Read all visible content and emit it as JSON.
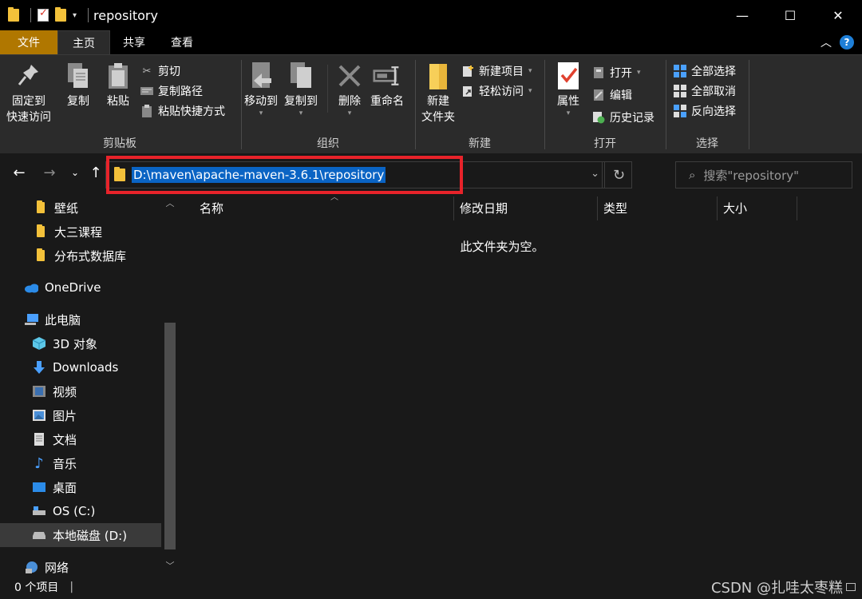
{
  "window": {
    "title": "repository",
    "minimize": "—",
    "maximize": "☐",
    "close": "✕"
  },
  "tabs": [
    "文件",
    "主页",
    "共享",
    "查看"
  ],
  "ribbon": {
    "clipboard": {
      "label": "剪贴板",
      "pin_line1": "固定到",
      "pin_line2": "快速访问",
      "copy": "复制",
      "paste": "粘贴",
      "cut": "剪切",
      "copy_path": "复制路径",
      "paste_shortcut": "粘贴快捷方式"
    },
    "organize": {
      "label": "组织",
      "move_to": "移动到",
      "copy_to": "复制到",
      "delete": "删除",
      "rename": "重命名"
    },
    "new": {
      "label": "新建",
      "new_folder_line1": "新建",
      "new_folder_line2": "文件夹",
      "new_item": "新建项目",
      "easy_access": "轻松访问"
    },
    "open": {
      "label": "打开",
      "properties": "属性",
      "open": "打开",
      "edit": "编辑",
      "history": "历史记录"
    },
    "select": {
      "label": "选择",
      "select_all": "全部选择",
      "select_none": "全部取消",
      "invert": "反向选择"
    }
  },
  "address_bar": {
    "path": "D:\\maven\\apache-maven-3.6.1\\repository"
  },
  "search": {
    "placeholder": "搜索\"repository\""
  },
  "nav_pane": {
    "items": [
      {
        "label": "壁纸",
        "icon": "folder-icon"
      },
      {
        "label": "大三课程",
        "icon": "folder-icon"
      },
      {
        "label": "分布式数据库",
        "icon": "folder-icon"
      },
      {
        "label": "OneDrive",
        "icon": "cloud-icon"
      },
      {
        "label": "此电脑",
        "icon": "computer-icon"
      },
      {
        "label": "3D 对象",
        "icon": "cube-icon"
      },
      {
        "label": "Downloads",
        "icon": "download-icon"
      },
      {
        "label": "视频",
        "icon": "video-icon"
      },
      {
        "label": "图片",
        "icon": "picture-icon"
      },
      {
        "label": "文档",
        "icon": "document-icon"
      },
      {
        "label": "音乐",
        "icon": "music-icon"
      },
      {
        "label": "桌面",
        "icon": "desktop-icon"
      },
      {
        "label": "OS (C:)",
        "icon": "drive-icon"
      },
      {
        "label": "本地磁盘 (D:)",
        "icon": "drive-icon"
      },
      {
        "label": "网络",
        "icon": "network-icon"
      }
    ]
  },
  "columns": {
    "name": "名称",
    "modified": "修改日期",
    "type": "类型",
    "size": "大小"
  },
  "content": {
    "empty_message": "此文件夹为空。"
  },
  "status": {
    "item_count": "0 个项目",
    "separator": "|"
  },
  "watermark": "CSDN @扎哇太枣糕"
}
